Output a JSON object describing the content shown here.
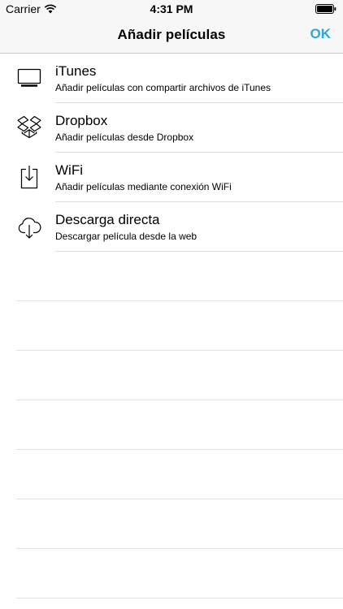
{
  "status_bar": {
    "carrier": "Carrier",
    "time": "4:31 PM"
  },
  "nav": {
    "title": "Añadir películas",
    "ok_label": "OK",
    "accent_color": "#2fa7d6"
  },
  "items": [
    {
      "icon": "monitor-icon",
      "title": "iTunes",
      "subtitle": "Añadir películas con compartir archivos de iTunes"
    },
    {
      "icon": "dropbox-icon",
      "title": "Dropbox",
      "subtitle": "Añadir películas desde Dropbox"
    },
    {
      "icon": "download-tray-icon",
      "title": "WiFi",
      "subtitle": "Añadir películas mediante conexión WiFi"
    },
    {
      "icon": "cloud-download-icon",
      "title": "Descarga directa",
      "subtitle": "Descargar película desde la web"
    }
  ]
}
